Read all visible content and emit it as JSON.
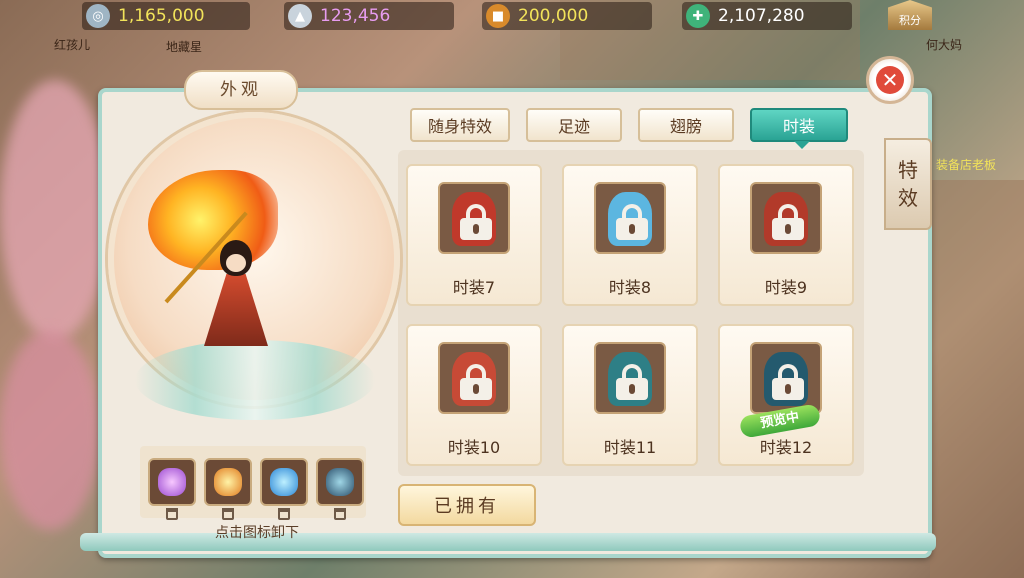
{
  "resources": [
    {
      "icon": "silver-coin-icon",
      "value": "1,165,000",
      "color": "#f2e35a"
    },
    {
      "icon": "silver-ingot-icon",
      "value": "123,456",
      "color": "#e79cf0"
    },
    {
      "icon": "copper-coin-icon",
      "value": "200,000",
      "color": "#f2e35a"
    },
    {
      "icon": "jade-money-tree-icon",
      "value": "2,107,280",
      "color": "#ffffff"
    }
  ],
  "score_label": "积分",
  "npc_names": [
    "红孩儿",
    "地藏星",
    "何大妈",
    "装备店老板"
  ],
  "panel": {
    "title": "外观",
    "equip_hint": "点击图标卸下",
    "equipped_icons": [
      "purple-aura-icon",
      "fire-orb-icon",
      "blue-wings-icon",
      "costume-icon"
    ]
  },
  "tabs": [
    {
      "label": "随身特效",
      "active": false
    },
    {
      "label": "足迹",
      "active": false
    },
    {
      "label": "翅膀",
      "active": false
    },
    {
      "label": "时装",
      "active": true
    }
  ],
  "items": [
    {
      "label": "时装7",
      "locked": true,
      "color": "#c0392b"
    },
    {
      "label": "时装8",
      "locked": true,
      "color": "#5cb6e0"
    },
    {
      "label": "时装9",
      "locked": true,
      "color": "#b23a2a"
    },
    {
      "label": "时装10",
      "locked": true,
      "color": "#c74a36"
    },
    {
      "label": "时装11",
      "locked": true,
      "color": "#2e7f86"
    },
    {
      "label": "时装12",
      "locked": true,
      "color": "#245a6e",
      "badge": "预览中"
    }
  ],
  "owned_button": "已拥有",
  "side_tab": [
    "特",
    "效"
  ],
  "colors": {
    "accent": "#2aa394",
    "panel_border": "#a9d6cc",
    "close": "#e04a3a"
  }
}
